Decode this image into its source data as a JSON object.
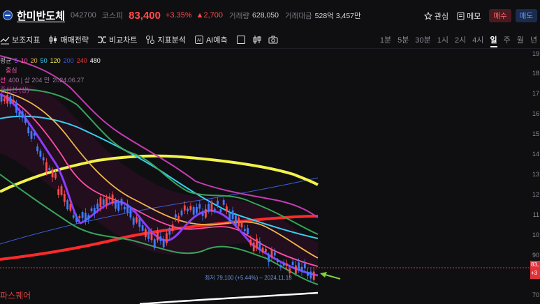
{
  "header": {
    "name": "한미반도체",
    "code": "042700",
    "market": "코스피",
    "price": "83,400",
    "change_pct": "+3.35%",
    "change_abs": "▲2,700",
    "volume_label": "거래량",
    "volume": "628,050",
    "amount_label": "거래대금",
    "amount": "528억 3,457만",
    "watch_label": "관심",
    "memo_label": "메모",
    "buy_label": "매수",
    "sell_label": "매도"
  },
  "toolbar": {
    "tools": [
      "보조지표",
      "매매전략",
      "비교차트",
      "지표분석",
      "AI예측"
    ],
    "periods": [
      "1분",
      "5분",
      "30분",
      "1시",
      "2시",
      "4시",
      "일",
      "주",
      "월",
      "년"
    ],
    "active_period": "일"
  },
  "legend": {
    "ma_prefix": "평균",
    "ma": [
      {
        "label": "5",
        "color": "#a259ff"
      },
      {
        "label": "10",
        "color": "#ff4fa3"
      },
      {
        "label": "20",
        "color": "#f0b64a"
      },
      {
        "label": "50",
        "color": "#37d0f2"
      },
      {
        "label": "120",
        "color": "#f2f24a"
      },
      {
        "label": "200",
        "color": "#3d5fd8"
      },
      {
        "label": "240",
        "color": "#ff3030"
      },
      {
        "label": "480",
        "color": "#ffffff"
      }
    ],
    "line2": "중심",
    "line3_a": "선",
    "line3_b": "400 | 상 204 만",
    "line3_date": "2024.06.27",
    "line4": "중심선 (상)"
  },
  "axis": {
    "ticks": [
      "19",
      "18",
      "17",
      "16",
      "15",
      "14",
      "13",
      "12",
      "11",
      "10",
      "90",
      "70"
    ],
    "price_tag_top": "83,",
    "price_tag_bottom": "+3"
  },
  "low_annotation": "최저 79,100 (+5.44%) – 2024.11.18",
  "watermark": "파스퀘어",
  "colors": {
    "up": "#ff4b4b",
    "down": "#3f7cff",
    "bg": "#0f0f12"
  }
}
